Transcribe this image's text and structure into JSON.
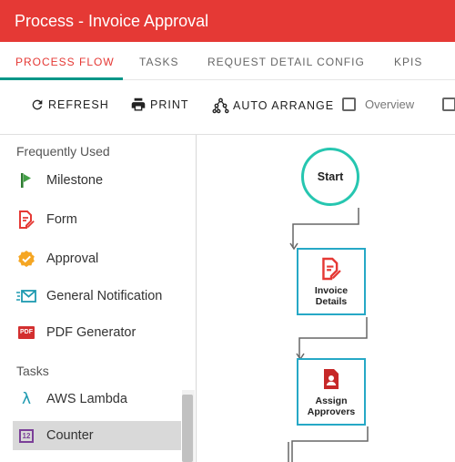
{
  "window": {
    "title": "Process - Invoice Approval"
  },
  "tabs": [
    {
      "label": "PROCESS FLOW",
      "active": true
    },
    {
      "label": "TASKS",
      "active": false
    },
    {
      "label": "REQUEST DETAIL CONFIG",
      "active": false
    },
    {
      "label": "KPIS",
      "active": false
    }
  ],
  "toolbar": {
    "refresh_label": "REFRESH",
    "print_label": "PRINT",
    "auto_arrange_label": "AUTO ARRANGE",
    "overview_label": "Overview",
    "overview_checked": false
  },
  "palette": {
    "sections": {
      "frequently_used": "Frequently Used",
      "tasks": "Tasks"
    },
    "frequent_items": [
      {
        "label": "Milestone",
        "icon": "flag-icon"
      },
      {
        "label": "Form",
        "icon": "form-icon"
      },
      {
        "label": "Approval",
        "icon": "approval-badge-icon"
      },
      {
        "label": "General Notification",
        "icon": "notification-mail-icon"
      },
      {
        "label": "PDF Generator",
        "icon": "pdf-icon",
        "icon_text": "PDF"
      }
    ],
    "task_items": [
      {
        "label": "AWS Lambda",
        "icon": "lambda-icon",
        "icon_text": "λ"
      },
      {
        "label": "Counter",
        "icon": "counter-icon",
        "icon_text": "12",
        "selected": true
      }
    ]
  },
  "canvas": {
    "start_label": "Start",
    "nodes": [
      {
        "label": "Invoice Details",
        "icon": "form-icon"
      },
      {
        "label": "Assign Approvers",
        "icon": "assign-user-icon"
      }
    ]
  },
  "colors": {
    "header": "#e53935",
    "tab_active": "#e53935",
    "tab_indicator": "#009688",
    "start_border": "#26c6b0",
    "node_border": "#26a8c6"
  }
}
